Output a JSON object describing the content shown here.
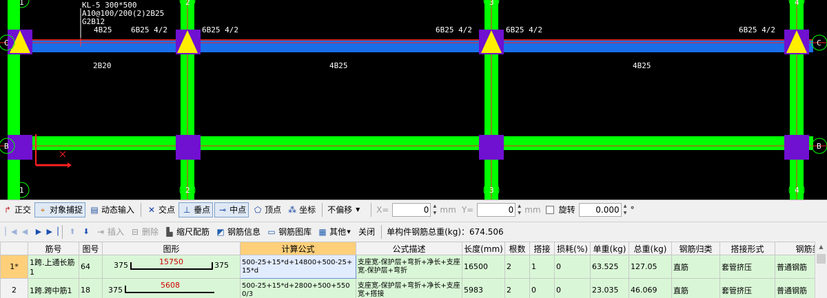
{
  "canvas": {
    "beam_annotation": [
      "KL-5 300*500",
      "A10@100/200(2)2B25",
      "G2B12"
    ],
    "top_labels": [
      "4B25",
      "6B25 4/2",
      "6B25 4/2",
      "6B25 4/2",
      "6B25 4/2",
      "6B25 4/2"
    ],
    "bottom_labels": [
      "2B20",
      "4B25",
      "4B25"
    ],
    "axis_top": [
      "1",
      "2",
      "3",
      "4"
    ],
    "axis_bottom": [
      "1",
      "2",
      "3",
      "4"
    ],
    "axis_left": [
      "C",
      "B"
    ],
    "axis_right": [
      "C",
      "B"
    ],
    "colors": {
      "column": "#7010d0",
      "beam": "#00ff00",
      "selected_beam": "#1a6ee8",
      "support": "#ffee00",
      "background": "#000000"
    }
  },
  "snap_toolbar": {
    "ortho": "正交",
    "object_snap": "对象捕捉",
    "dynamic_input": "动态输入",
    "intersection": "交点",
    "perpendicular": "垂点",
    "midpoint": "中点",
    "vertex": "顶点",
    "coordinate": "坐标",
    "offset_mode": "不偏移",
    "x_label": "X=",
    "x_value": "0",
    "x_unit": "mm",
    "y_label": "Y=",
    "y_value": "0",
    "y_unit": "mm",
    "rotate": "旋转",
    "rotate_value": "0.000",
    "degree": "°"
  },
  "rebar_toolbar": {
    "insert": "插入",
    "delete": "删除",
    "scale_rebar": "缩尺配筋",
    "rebar_info": "钢筋信息",
    "rebar_library": "钢筋图库",
    "other": "其他",
    "close": "关闭",
    "total_weight_label": "单构件钢筋总重(kg)：674.506"
  },
  "table": {
    "headers": [
      "筋号",
      "图号",
      "图形",
      "计算公式",
      "公式描述",
      "长度(mm)",
      "根数",
      "搭接",
      "损耗(%)",
      "单重(kg)",
      "总重(kg)",
      "钢筋归类",
      "搭接形式",
      "钢筋类型"
    ],
    "rows": [
      {
        "rownum": "1*",
        "name": "1跨.上通长筋1",
        "fig": "64",
        "shape_left": "375",
        "shape_mid": "15750",
        "shape_right": "375",
        "formula": "500-25+15*d+14800+500-25+15*d",
        "desc": "支座宽-保护层+弯折+净长+支座宽-保护层+弯折",
        "length": "16500",
        "count": "2",
        "lap": "1",
        "loss": "0",
        "unit_w": "63.525",
        "total_w": "127.05",
        "category": "直筋",
        "lap_type": "套管挤压",
        "rebar_type": "普通钢筋"
      },
      {
        "rownum": "2",
        "name": "1跨.跨中筋1",
        "fig": "18",
        "shape_left": "375",
        "shape_mid": "5608",
        "shape_right": "",
        "formula": "500-25+15*d+2800+500+5500/3",
        "desc": "支座宽-保护层+弯折+净长+支座宽+搭接",
        "length": "5983",
        "count": "2",
        "lap": "0",
        "loss": "0",
        "unit_w": "23.035",
        "total_w": "46.069",
        "category": "直筋",
        "lap_type": "套管挤压",
        "rebar_type": "普通钢筋"
      }
    ]
  }
}
